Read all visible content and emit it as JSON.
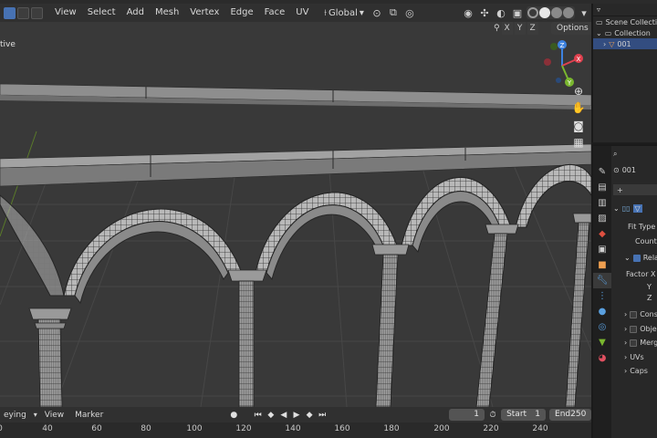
{
  "header": {
    "menus": [
      "View",
      "Select",
      "Add",
      "Mesh",
      "Vertex",
      "Edge",
      "Face",
      "UV"
    ],
    "orientation": "Global"
  },
  "viewport": {
    "mode_label": "tive",
    "symmetry_axes": [
      "X",
      "Y",
      "Z"
    ],
    "options_label": "Options",
    "gizmo_axes": {
      "x": "X",
      "y": "Y",
      "z": "Z"
    }
  },
  "timeline": {
    "mode": "eying",
    "view_label": "View",
    "marker_label": "Marker",
    "current_frame": "1",
    "start_label": "Start",
    "start_value": "1",
    "end_label": "End",
    "end_value": "250",
    "ruler_ticks": [
      "0",
      "40",
      "60",
      "80",
      "100",
      "120",
      "140",
      "160",
      "180",
      "200",
      "220",
      "240"
    ]
  },
  "outliner": {
    "rows": [
      {
        "label": "Scene Collecti",
        "selected": false
      },
      {
        "label": "Collection",
        "selected": false
      },
      {
        "label": "001",
        "selected": true
      }
    ]
  },
  "properties": {
    "object_name": "001",
    "fit_type_label": "Fit Type",
    "count_label": "Count",
    "relative_label": "Relati",
    "factor_x_label": "Factor X",
    "y_label": "Y",
    "z_label": "Z",
    "const_label": "Const",
    "object_label": "Object",
    "merge_label": "Merge",
    "uvs_label": "UVs",
    "caps_label": "Caps"
  },
  "colors": {
    "accent": "#4772b3",
    "axis_x": "#e0414f",
    "axis_y": "#7ab72f",
    "axis_z": "#3d82e0",
    "viewport_bg": "#393939"
  }
}
